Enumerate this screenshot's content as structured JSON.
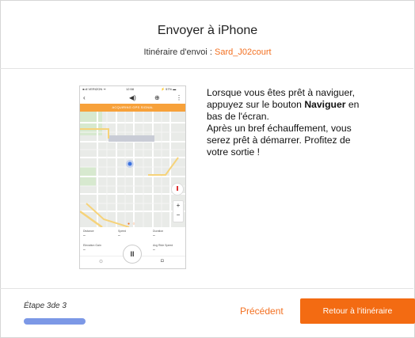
{
  "dialog": {
    "title": "Envoyer à iPhone",
    "route_label": "Itinéraire d'envoi : ",
    "route_name": "Sard_J02court"
  },
  "phone": {
    "status_carrier": "●ııll VERIZON ᯤ",
    "status_time": "12:58",
    "status_right": "⚡ 57% ▬",
    "banner": "ACQUIRING GPS SIGNAL",
    "toolbar_icons": [
      "back-icon",
      "speaker-icon",
      "route-pin-icon",
      "more-icon"
    ],
    "stats": [
      {
        "label": "Distance",
        "value": "–"
      },
      {
        "label": "Speed",
        "value": "–"
      },
      {
        "label": "Duration",
        "value": "–"
      },
      {
        "label": "Elevation Gain",
        "value": "–"
      },
      {
        "label": "Avg Ride Speed",
        "value": "–"
      }
    ],
    "zoom_in": "+",
    "zoom_out": "−",
    "pause": "II"
  },
  "instructions": {
    "part1": "Lorsque vous êtes prêt à naviguer, appuyez sur le bouton ",
    "bold": "Naviguer",
    "part2": " en bas de l'écran.",
    "part3": "Après un bref échauffement, vous serez prêt à démarrer. Profitez de votre sortie !"
  },
  "footer": {
    "step_label": "Étape 3de 3",
    "progress": 1.0,
    "prev_label": "Précédent",
    "primary_label": "Retour à l'itinéraire"
  },
  "colors": {
    "accent": "#f37021",
    "primary_button": "#f36b12",
    "progress": "#7c98e6",
    "banner": "#f7a13a"
  }
}
